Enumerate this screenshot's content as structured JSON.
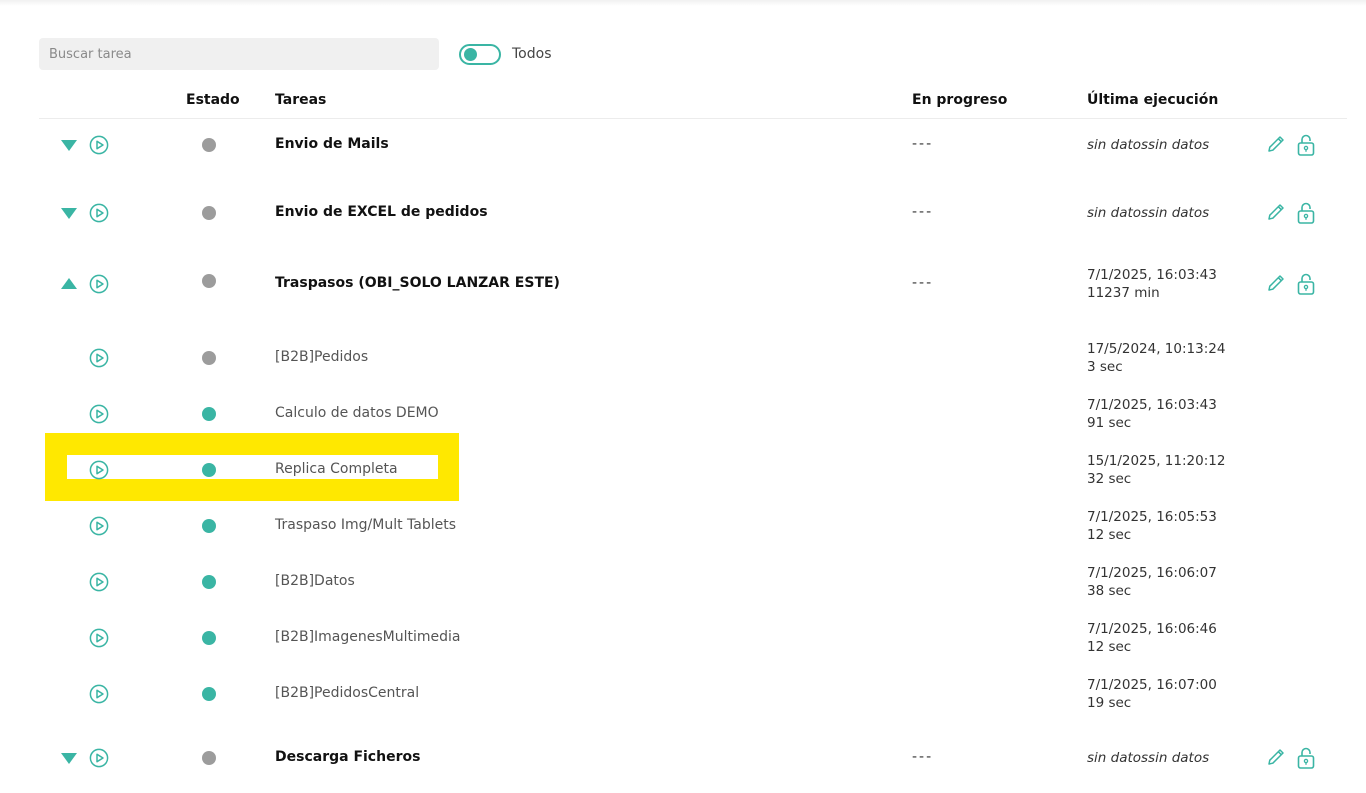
{
  "search": {
    "placeholder": "Buscar tarea",
    "value": ""
  },
  "filter": {
    "toggle_label": "Todos",
    "on": false
  },
  "columns": {
    "estado": "Estado",
    "tareas": "Tareas",
    "en_progreso": "En progreso",
    "ultima_ejecucion": "Última ejecución"
  },
  "colors": {
    "accent": "#3ab5a4",
    "status_inactive": "#9c9c9c",
    "highlight": "#ffe800"
  },
  "rows": [
    {
      "name": "Envio de Mails",
      "progress": "---",
      "last": "sin datossin datos",
      "status": "inactive"
    },
    {
      "name": "Envio de EXCEL de pedidos",
      "progress": "---",
      "last": "sin datossin datos",
      "status": "inactive"
    },
    {
      "name": "Traspasos (OBI_SOLO LANZAR ESTE)",
      "progress": "---",
      "last_date": "7/1/2025, 16:03:43",
      "last_duration": "11237 min",
      "status": "inactive",
      "expanded": true
    },
    {
      "name": "[B2B]Pedidos",
      "last_date": "17/5/2024, 10:13:24",
      "last_duration": "3 sec",
      "status": "inactive"
    },
    {
      "name": "Calculo de datos DEMO",
      "last_date": "7/1/2025, 16:03:43",
      "last_duration": "91 sec",
      "status": "active"
    },
    {
      "name": "Replica Completa",
      "last_date": "15/1/2025, 11:20:12",
      "last_duration": "32 sec",
      "status": "active",
      "highlighted": true
    },
    {
      "name": "Traspaso Img/Mult Tablets",
      "last_date": "7/1/2025, 16:05:53",
      "last_duration": "12 sec",
      "status": "active"
    },
    {
      "name": "[B2B]Datos",
      "last_date": "7/1/2025, 16:06:07",
      "last_duration": "38 sec",
      "status": "active"
    },
    {
      "name": "[B2B]ImagenesMultimedia",
      "last_date": "7/1/2025, 16:06:46",
      "last_duration": "12 sec",
      "status": "active"
    },
    {
      "name": "[B2B]PedidosCentral",
      "last_date": "7/1/2025, 16:07:00",
      "last_duration": "19 sec",
      "status": "active"
    },
    {
      "name": "Descarga Ficheros",
      "progress": "---",
      "last": "sin datossin datos",
      "status": "inactive"
    }
  ]
}
